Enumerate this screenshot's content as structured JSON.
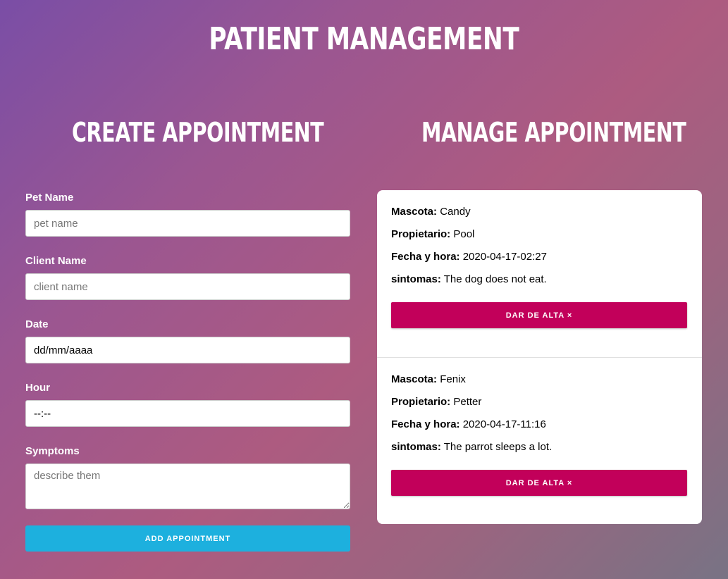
{
  "header": {
    "title": "PATIENT MANAGEMENT"
  },
  "create": {
    "title": "CREATE APPOINTMENT",
    "pet_label": "Pet Name",
    "pet_placeholder": "pet name",
    "client_label": "Client Name",
    "client_placeholder": "client name",
    "date_label": "Date",
    "date_value": "dd/mm/aaaa",
    "hour_label": "Hour",
    "hour_value": "--:--",
    "symptoms_label": "Symptoms",
    "symptoms_placeholder": "describe them",
    "submit_label": "ADD APPOINTMENT"
  },
  "manage": {
    "title": "MANAGE APPOINTMENT",
    "labels": {
      "pet": "Mascota:",
      "owner": "Propietario:",
      "datetime": "Fecha y hora:",
      "symptoms": "sintomas:"
    },
    "delete_label": "DAR DE ALTA ×",
    "appointments": [
      {
        "pet": "Candy",
        "owner": "Pool",
        "datetime": "2020-04-17-02:27",
        "symptoms": "The dog does not eat."
      },
      {
        "pet": "Fenix",
        "owner": "Petter",
        "datetime": "2020-04-17-11:16",
        "symptoms": "The parrot sleeps a lot."
      }
    ]
  },
  "colors": {
    "add_button": "#1db0de",
    "delete_button": "#c2005a",
    "background_start": "#7a4ea6",
    "background_end": "#787384"
  }
}
